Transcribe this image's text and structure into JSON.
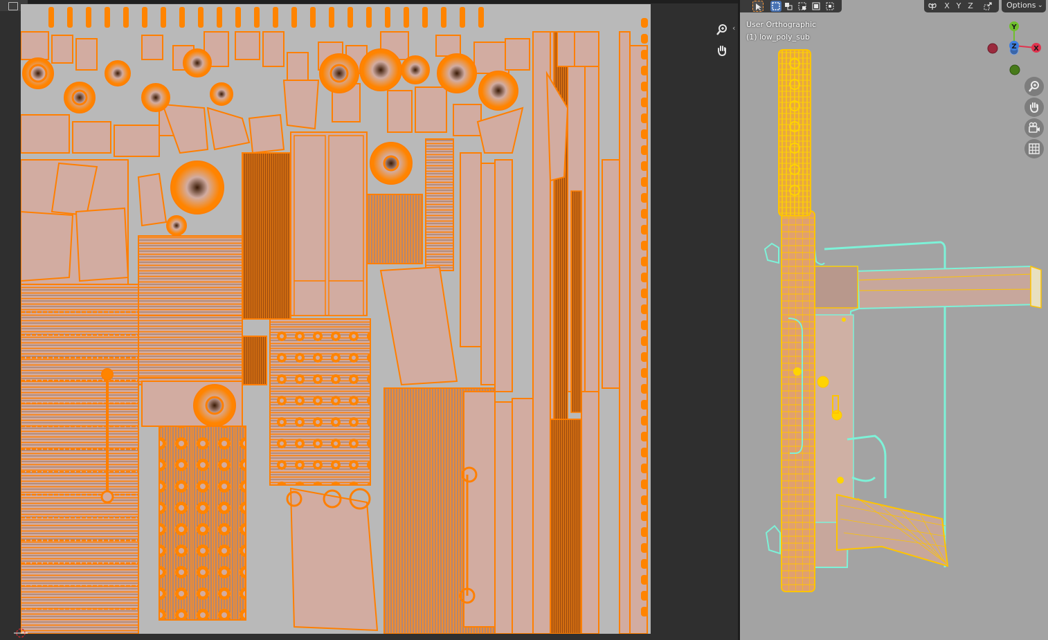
{
  "uv_editor": {
    "header_icon": "image-editor-icon",
    "nav_icons": [
      "zoom-icon",
      "hand-pan-icon"
    ],
    "collapse_glyph": "‹",
    "colors": {
      "canvas": "#b9b9b9",
      "island_fill": "#d2aca1",
      "edge": "#ff7f00",
      "dark_edge": "#6a3b10"
    }
  },
  "viewport": {
    "view_name": "User Orthographic",
    "object_name": "(1) low_poly_sub",
    "axis_toggles": [
      "X",
      "Y",
      "Z"
    ],
    "options_label": "Options",
    "options_chevron": "⌄",
    "gizmo": {
      "y_label": "Y",
      "z_label": "Z",
      "x_label": "X"
    },
    "nav_icons": [
      "zoom-icon",
      "hand-pan-icon",
      "camera-icon",
      "grid-icon"
    ],
    "colors": {
      "background": "#a3a3a3",
      "wire_selected": "#ffc400",
      "wire_active": "#7df2d8",
      "face": "#c7a79c"
    }
  }
}
